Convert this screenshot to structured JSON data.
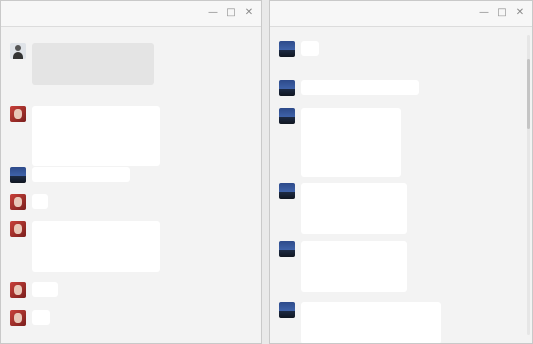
{
  "windows": [
    {
      "title": "",
      "messages": [
        {
          "avatar": "person-avatar",
          "sender": "",
          "style": "grey",
          "lines": [
            "",
            "",
            "",
            ""
          ]
        },
        {
          "avatar": "red-avatar",
          "sender": "",
          "style": "white",
          "lines": [
            "",
            "",
            "",
            "",
            "",
            ""
          ]
        },
        {
          "avatar": "mountain-avatar",
          "sender": "",
          "style": "white",
          "lines": [
            ""
          ]
        },
        {
          "avatar": "red-avatar",
          "sender": "",
          "style": "white",
          "lines": [
            ""
          ]
        },
        {
          "avatar": "red-avatar",
          "sender": "",
          "style": "white",
          "lines": [
            "",
            "",
            "",
            "",
            ""
          ]
        },
        {
          "avatar": "red-avatar",
          "sender": "",
          "style": "white",
          "lines": [
            ""
          ]
        },
        {
          "avatar": "red-avatar",
          "sender": "",
          "style": "white",
          "lines": [
            ""
          ]
        }
      ]
    },
    {
      "title": "",
      "messages": [
        {
          "avatar": "mountain-avatar",
          "sender": "",
          "style": "white",
          "lines": [
            ""
          ]
        },
        {
          "avatar": "mountain-avatar",
          "sender": "",
          "style": "white",
          "lines": [
            ""
          ]
        },
        {
          "avatar": "mountain-avatar",
          "sender": "",
          "style": "white",
          "lines": [
            "",
            "",
            "",
            "",
            "",
            "",
            ""
          ]
        },
        {
          "avatar": "mountain-avatar",
          "sender": "",
          "style": "white",
          "lines": [
            "",
            "",
            "",
            "",
            ""
          ]
        },
        {
          "avatar": "mountain-avatar",
          "sender": "",
          "style": "white",
          "lines": [
            "",
            "",
            "",
            "",
            ""
          ]
        },
        {
          "avatar": "mountain-avatar",
          "sender": "",
          "style": "white",
          "lines": [
            "",
            "",
            "",
            ""
          ]
        }
      ]
    }
  ],
  "colors": {
    "window_bg": "#f3f3f3",
    "bubble_white": "#ffffff",
    "bubble_grey": "#e4e4e4",
    "sender_text": "#9a9a9a"
  }
}
